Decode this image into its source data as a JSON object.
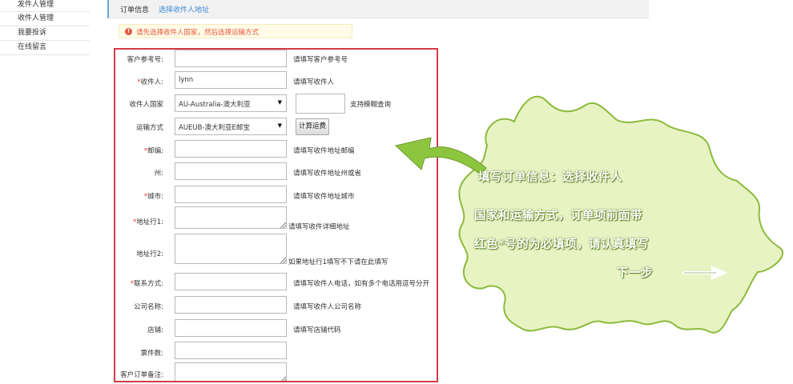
{
  "sidebar": {
    "items": [
      "发件人管理",
      "收件人管理",
      "我要投诉",
      "在线留言"
    ]
  },
  "tabs": {
    "active": "订单信息",
    "link": "选择收件人地址"
  },
  "alert": {
    "icon": "info-icon",
    "message": "请先选择收件人国家，然后选择运输方式"
  },
  "form": {
    "ref": {
      "label": "客户参考号:",
      "value": "",
      "hint": "请填写客户参考号"
    },
    "recipient": {
      "label": "收件人:",
      "value": "lynn",
      "hint": "请填写收件人"
    },
    "country": {
      "label": "收件人国家",
      "value": "AU-Australia-澳大利亚",
      "search_value": "",
      "hint": "支持模糊查询"
    },
    "shipping": {
      "label": "运输方式",
      "value": "AUEUB-澳大利亚E邮宝",
      "button": "计算运费"
    },
    "zip": {
      "label": "邮编:",
      "value": "",
      "hint": "请填写收件地址邮编"
    },
    "state": {
      "label": "州:",
      "value": "",
      "hint": "请填写收件地址州或省"
    },
    "city": {
      "label": "城市:",
      "value": "",
      "hint": "请填写收件地址城市"
    },
    "addr1": {
      "label": "地址行1:",
      "value": "",
      "hint": "请填写收件详细地址"
    },
    "addr2": {
      "label": "地址行2:",
      "value": "",
      "hint": "如果地址行1填写不下请在此填写"
    },
    "phone": {
      "label": "联系方式:",
      "value": "",
      "hint": "请填写收件人电话，如有多个电话用逗号分开"
    },
    "company": {
      "label": "公司名称:",
      "value": "",
      "hint": "请填写收件人公司名称"
    },
    "shop": {
      "label": "店铺:",
      "value": "",
      "hint": "请填写店铺代码"
    },
    "pieces": {
      "label": "票件数:",
      "value": ""
    },
    "remark": {
      "label": "客户订单备注:",
      "value": ""
    }
  },
  "callout": {
    "lines": [
      "填写订单信息：选择收件人",
      "国家和运输方式，订单项前面带",
      "红色*号的为必填项，请认真填写",
      "下一步"
    ],
    "colors": {
      "fill": "#e8f3c4",
      "stroke": "#8cba3c",
      "arrow": "#8cc63f"
    }
  }
}
